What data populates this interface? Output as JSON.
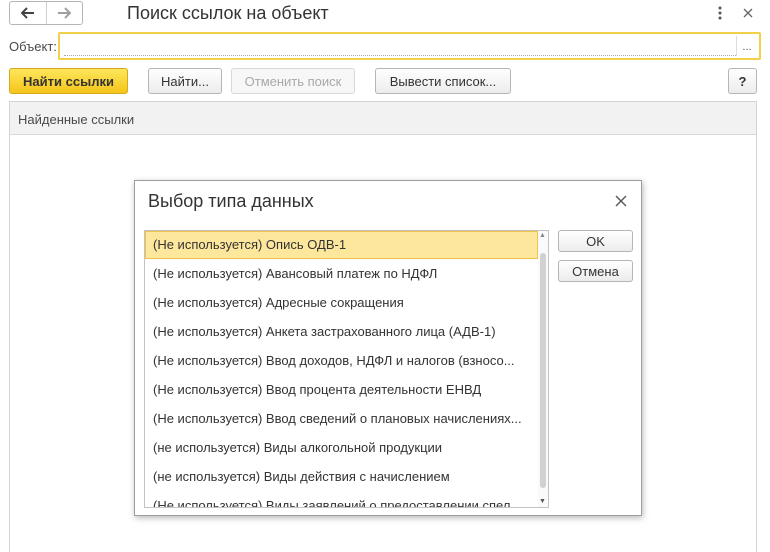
{
  "header": {
    "title": "Поиск ссылок на объект",
    "back_icon": "arrow-left-icon",
    "forward_icon": "arrow-right-icon",
    "menu_icon": "kebab-menu-icon",
    "close_icon": "close-icon"
  },
  "object_field": {
    "label": "Объект:",
    "value": "",
    "select_label": "..."
  },
  "toolbar": {
    "find_refs_label": "Найти ссылки",
    "find_label": "Найти...",
    "cancel_search_label": "Отменить поиск",
    "output_list_label": "Вывести список...",
    "help_label": "?"
  },
  "results": {
    "header_label": "Найденные ссылки"
  },
  "dialog": {
    "title": "Выбор типа данных",
    "ok_label": "OK",
    "cancel_label": "Отмена",
    "items": [
      "(Не используется) Опись ОДВ-1",
      "(Не используется) Авансовый платеж по НДФЛ",
      "(Не используется) Адресные сокращения",
      "(Не используется) Анкета застрахованного лица (АДВ-1)",
      "(Не используется) Ввод доходов, НДФЛ и налогов (взносо...",
      "(Не используется) Ввод процента деятельности ЕНВД",
      "(Не используется) Ввод сведений о плановых начислениях...",
      "(не используется) Виды алкогольной продукции",
      "(не используется) Виды действия с начислением",
      "(Не используется) Виды заявлений о предоставлении спел..."
    ],
    "selected_index": 0
  },
  "colors": {
    "accent_yellow": "#f5c51a",
    "field_border": "#f2d04a",
    "selection_bg": "#fde79d"
  }
}
